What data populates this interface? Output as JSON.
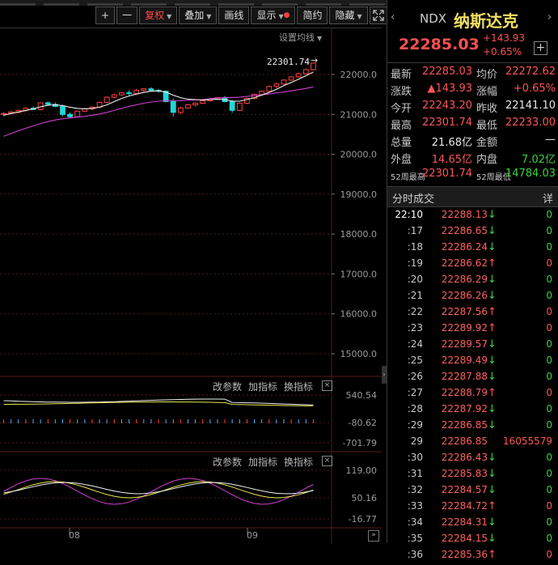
{
  "toolbar": {
    "plus": "+",
    "minus": "一",
    "fuquan": "复权",
    "overlay": "叠加",
    "draw": "画线",
    "display": "显示",
    "simple": "简约",
    "hide": "隐藏",
    "fullscreen_icon": "expand-icon"
  },
  "main_chart": {
    "ma_settings": "设置均线",
    "high_label": "22301.74",
    "y_ticks": [
      "22000.0",
      "21000.0",
      "20000.0",
      "19000.0",
      "18000.0",
      "17000.0",
      "16000.0",
      "15000.0"
    ],
    "x_ticks": [
      "08",
      "09"
    ],
    "candles": [
      [
        21000,
        21050,
        20950,
        21020
      ],
      [
        21030,
        21080,
        21000,
        21060
      ],
      [
        21050,
        21120,
        21030,
        21100
      ],
      [
        21100,
        21180,
        21060,
        21150
      ],
      [
        21150,
        21200,
        21110,
        21120
      ],
      [
        21120,
        21300,
        21100,
        21290
      ],
      [
        21290,
        21320,
        21230,
        21250
      ],
      [
        21250,
        21300,
        21180,
        21200
      ],
      [
        21200,
        21240,
        20950,
        21000
      ],
      [
        21000,
        21050,
        20900,
        20940
      ],
      [
        20940,
        21100,
        20920,
        21080
      ],
      [
        21080,
        21160,
        21060,
        21140
      ],
      [
        21140,
        21200,
        21100,
        21180
      ],
      [
        21180,
        21320,
        21160,
        21300
      ],
      [
        21300,
        21450,
        21280,
        21430
      ],
      [
        21430,
        21520,
        21400,
        21490
      ],
      [
        21490,
        21560,
        21460,
        21540
      ],
      [
        21540,
        21600,
        21480,
        21520
      ],
      [
        21520,
        21640,
        21500,
        21600
      ],
      [
        21600,
        21660,
        21560,
        21640
      ],
      [
        21640,
        21680,
        21590,
        21600
      ],
      [
        21600,
        21640,
        21540,
        21580
      ],
      [
        21580,
        21600,
        21300,
        21320
      ],
      [
        21320,
        21400,
        20950,
        21050
      ],
      [
        21050,
        21200,
        21000,
        21160
      ],
      [
        21160,
        21260,
        21140,
        21240
      ],
      [
        21240,
        21300,
        21200,
        21280
      ],
      [
        21280,
        21360,
        21260,
        21340
      ],
      [
        21340,
        21420,
        21320,
        21380
      ],
      [
        21380,
        21440,
        21360,
        21420
      ],
      [
        21420,
        21460,
        21300,
        21320
      ],
      [
        21320,
        21360,
        21040,
        21100
      ],
      [
        21100,
        21300,
        21080,
        21280
      ],
      [
        21280,
        21420,
        21260,
        21400
      ],
      [
        21400,
        21520,
        21380,
        21500
      ],
      [
        21500,
        21600,
        21480,
        21580
      ],
      [
        21580,
        21720,
        21560,
        21700
      ],
      [
        21700,
        21800,
        21660,
        21760
      ],
      [
        21760,
        21880,
        21740,
        21860
      ],
      [
        21860,
        21960,
        21840,
        21940
      ],
      [
        21940,
        22050,
        21920,
        22020
      ],
      [
        22020,
        22150,
        22000,
        22120
      ],
      [
        22120,
        22302,
        22100,
        22285
      ]
    ],
    "ma_short": [
      20980,
      21020,
      21060,
      21100,
      21140,
      21190,
      21230,
      21240,
      21220,
      21180,
      21150,
      21140,
      21150,
      21180,
      21240,
      21320,
      21400,
      21460,
      21510,
      21550,
      21580,
      21590,
      21560,
      21480,
      21420,
      21380,
      21370,
      21360,
      21370,
      21380,
      21370,
      21330,
      21330,
      21370,
      21420,
      21480,
      21550,
      21630,
      21720,
      21800,
      21880,
      21970,
      22060
    ],
    "ma_long": [
      20450,
      20520,
      20590,
      20650,
      20710,
      20770,
      20820,
      20860,
      20890,
      20910,
      20930,
      20950,
      20980,
      21010,
      21050,
      21100,
      21150,
      21200,
      21240,
      21280,
      21310,
      21330,
      21340,
      21340,
      21340,
      21350,
      21360,
      21370,
      21390,
      21410,
      21420,
      21420,
      21430,
      21450,
      21470,
      21490,
      21510,
      21540,
      21560,
      21590,
      21620,
      21650,
      21690
    ]
  },
  "sub1": {
    "btn_params": "改参数",
    "btn_add": "加指标",
    "btn_switch": "换指标",
    "close": "×",
    "y_ticks": [
      "540.54",
      "-80.62",
      "-701.79"
    ]
  },
  "sub2": {
    "btn_params": "改参数",
    "btn_add": "加指标",
    "btn_switch": "换指标",
    "close": "×",
    "y_ticks": [
      "119.00",
      "50.16",
      "-16.77"
    ]
  },
  "quote": {
    "code": "NDX",
    "name": "纳斯达克",
    "price": "22285.03",
    "change": "+143.93",
    "change_pct": "+0.65%",
    "add": "+",
    "rows": [
      {
        "k": "最新",
        "v": "22285.03",
        "vc": "red",
        "k2": "均价",
        "v2": "22272.62",
        "v2c": "red"
      },
      {
        "k": "涨跌",
        "v": "▲143.93",
        "vc": "red",
        "k2": "涨幅",
        "v2": "+0.65%",
        "v2c": "red"
      },
      {
        "k": "今开",
        "v": "22243.20",
        "vc": "red",
        "k2": "昨收",
        "v2": "22141.10",
        "v2c": "white"
      },
      {
        "k": "最高",
        "v": "22301.74",
        "vc": "red",
        "k2": "最低",
        "v2": "22233.00",
        "v2c": "red"
      },
      {
        "k": "总量",
        "v": "21.68亿",
        "vc": "white",
        "k2": "金额",
        "v2": "—",
        "v2c": "white"
      },
      {
        "k": "外盘",
        "v": "14.65亿",
        "vc": "red",
        "k2": "内盘",
        "v2": "7.02亿",
        "v2c": "green"
      },
      {
        "k": "52周最高",
        "v": "22301.74",
        "vc": "red",
        "k2": "52周最低",
        "v2": "14784.03",
        "v2c": "green"
      }
    ]
  },
  "ticks": {
    "title": "分时成交",
    "detail": "详",
    "rows": [
      {
        "t": "22:10",
        "p": "22288.13",
        "d": "down",
        "v": "0"
      },
      {
        "t": ":17",
        "p": "22286.65",
        "d": "down",
        "v": "0"
      },
      {
        "t": ":18",
        "p": "22286.24",
        "d": "down",
        "v": "0"
      },
      {
        "t": ":19",
        "p": "22286.62",
        "d": "up",
        "v": "0"
      },
      {
        "t": ":20",
        "p": "22286.29",
        "d": "down",
        "v": "0"
      },
      {
        "t": ":21",
        "p": "22286.26",
        "d": "down",
        "v": "0"
      },
      {
        "t": ":22",
        "p": "22287.56",
        "d": "up",
        "v": "0"
      },
      {
        "t": ":23",
        "p": "22289.92",
        "d": "up",
        "v": "0"
      },
      {
        "t": ":24",
        "p": "22289.57",
        "d": "down",
        "v": "0"
      },
      {
        "t": ":25",
        "p": "22289.49",
        "d": "down",
        "v": "0"
      },
      {
        "t": ":26",
        "p": "22287.88",
        "d": "down",
        "v": "0"
      },
      {
        "t": ":27",
        "p": "22288.79",
        "d": "up",
        "v": "0"
      },
      {
        "t": ":28",
        "p": "22287.92",
        "d": "down",
        "v": "0"
      },
      {
        "t": ":29",
        "p": "22286.85",
        "d": "down",
        "v": "0"
      },
      {
        "t": "29",
        "p": "22286.85",
        "d": "none",
        "v": "16055579"
      },
      {
        "t": ":30",
        "p": "22286.43",
        "d": "down",
        "v": "0"
      },
      {
        "t": ":31",
        "p": "22285.83",
        "d": "down",
        "v": "0"
      },
      {
        "t": ":32",
        "p": "22284.57",
        "d": "down",
        "v": "0"
      },
      {
        "t": ":33",
        "p": "22284.72",
        "d": "up",
        "v": "0"
      },
      {
        "t": ":34",
        "p": "22284.31",
        "d": "down",
        "v": "0"
      },
      {
        "t": ":35",
        "p": "22284.15",
        "d": "down",
        "v": "0"
      },
      {
        "t": ":36",
        "p": "22285.36",
        "d": "up",
        "v": "0"
      }
    ]
  },
  "colors": {
    "up": "#ff4040",
    "down": "#23d6d6",
    "ma_short": "#f0f0f0",
    "ma_long": "#d040d0",
    "grid": "#5a1a1a"
  }
}
